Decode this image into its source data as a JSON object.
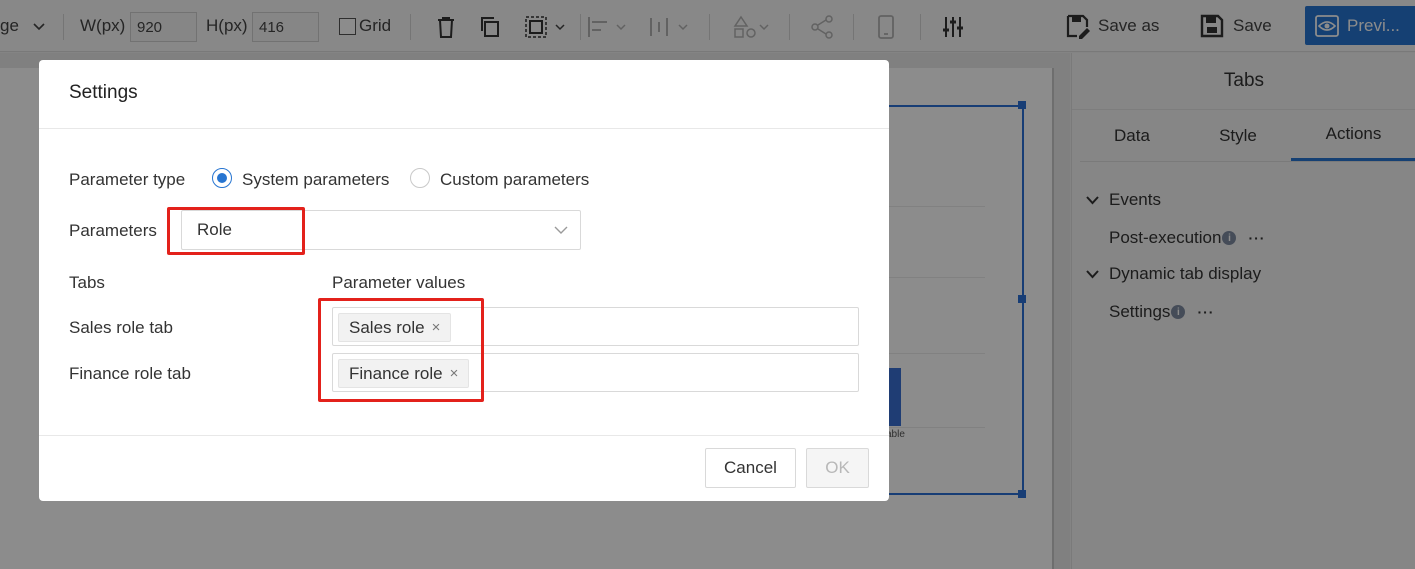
{
  "toolbar": {
    "page_label": "ge",
    "width_label": "W(px)",
    "width_value": "920",
    "height_label": "H(px)",
    "height_value": "416",
    "grid_label": "Grid",
    "save_as_label": "Save as",
    "save_label": "Save",
    "preview_label": "Previ..."
  },
  "canvas": {
    "fragment_text": "able"
  },
  "right_panel": {
    "title": "Tabs",
    "tabs": [
      "Data",
      "Style",
      "Actions"
    ],
    "active_tab": "Actions",
    "tree": {
      "events": "Events",
      "post_execution": "Post-execution",
      "dynamic_tab_display": "Dynamic tab display",
      "settings": "Settings"
    },
    "more_glyph": "···",
    "info_glyph": "i"
  },
  "dialog": {
    "title": "Settings",
    "parameter_type_label": "Parameter type",
    "radio_system": "System parameters",
    "radio_custom": "Custom parameters",
    "selected_radio": "System parameters",
    "parameters_label": "Parameters",
    "parameters_value": "Role",
    "col_tabs": "Tabs",
    "col_param_values": "Parameter values",
    "rows": [
      {
        "tab": "Sales role tab",
        "value": "Sales role"
      },
      {
        "tab": "Finance role tab",
        "value": "Finance role"
      }
    ],
    "tag_remove_glyph": "×",
    "cancel_label": "Cancel",
    "ok_label": "OK"
  },
  "colors": {
    "accent": "#2775d1",
    "highlight": "#e3211b"
  }
}
